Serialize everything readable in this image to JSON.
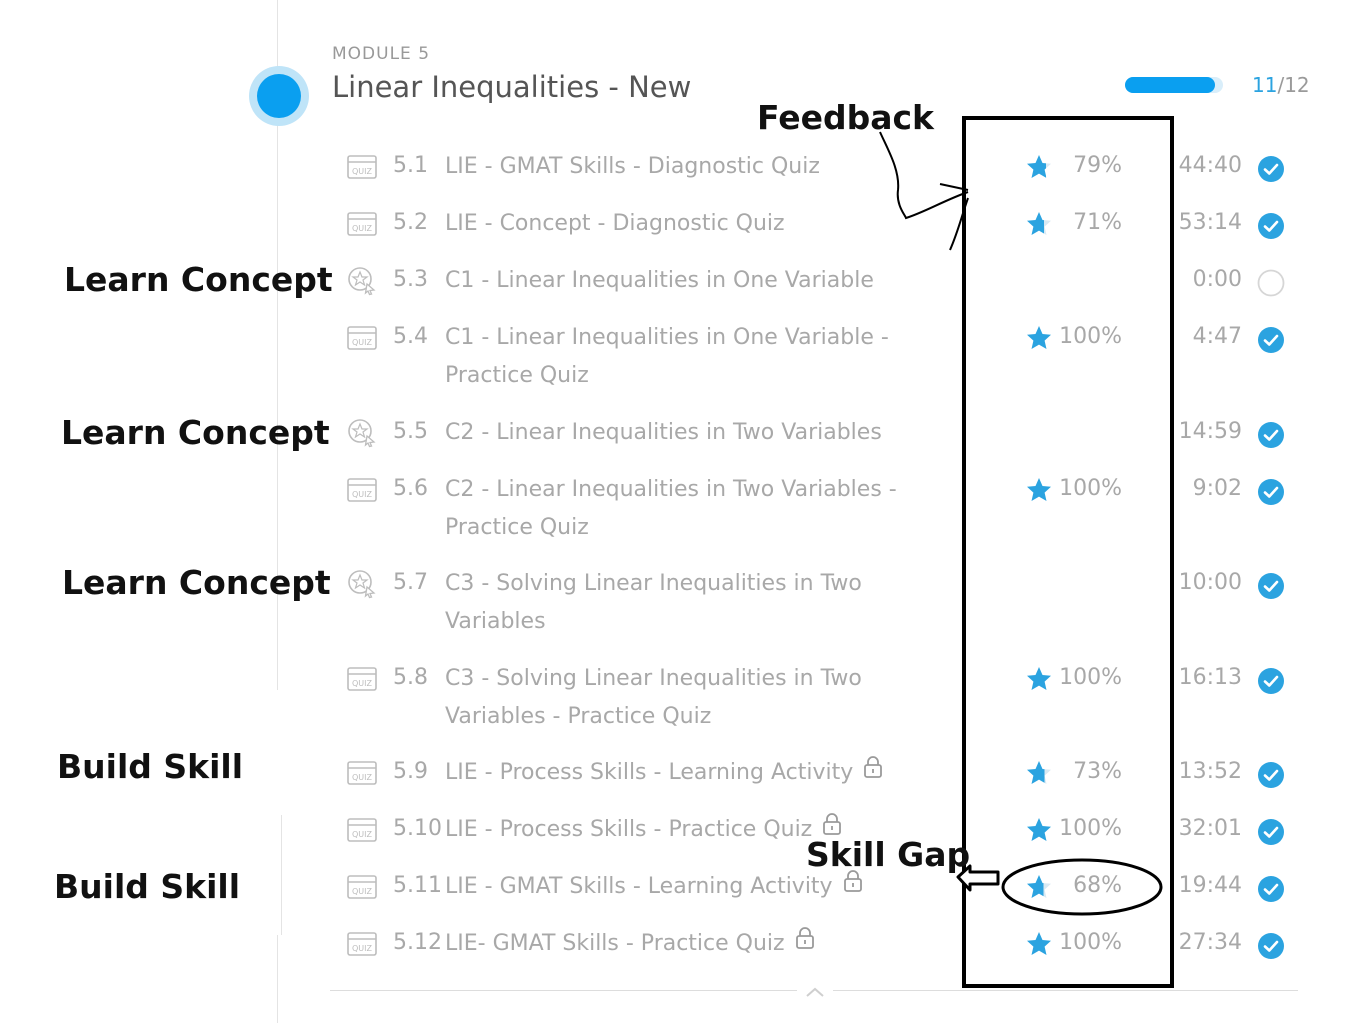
{
  "module": {
    "label": "MODULE 5",
    "title": "Linear Inequalities - New",
    "progress_fraction": 0.917,
    "progress_done": "11",
    "progress_total": "/12"
  },
  "lessons": [
    {
      "num": "5.1",
      "title": "LIE - GMAT Skills - Diagnostic Quiz",
      "icon": "quiz-icon",
      "score": "79%",
      "star_fraction": 0.79,
      "time": "44:40",
      "status": "completed",
      "locked": false
    },
    {
      "num": "5.2",
      "title": "LIE - Concept - Diagnostic Quiz",
      "icon": "quiz-icon",
      "score": "71%",
      "star_fraction": 0.71,
      "time": "53:14",
      "status": "completed",
      "locked": false
    },
    {
      "num": "5.3",
      "title": "C1 - Linear Inequalities in One Variable",
      "icon": "concept-icon",
      "score": "",
      "star_fraction": null,
      "time": "0:00",
      "status": "not-started",
      "locked": false
    },
    {
      "num": "5.4",
      "title": "C1 - Linear Inequalities in One Variable - Practice Quiz",
      "icon": "quiz-icon",
      "score": "100%",
      "star_fraction": 1,
      "time": "4:47",
      "status": "completed",
      "locked": false
    },
    {
      "num": "5.5",
      "title": "C2 - Linear Inequalities in Two Variables",
      "icon": "concept-icon",
      "score": "",
      "star_fraction": null,
      "time": "14:59",
      "status": "completed",
      "locked": false
    },
    {
      "num": "5.6",
      "title": "C2 - Linear Inequalities in Two Variables - Practice Quiz",
      "icon": "quiz-icon",
      "score": "100%",
      "star_fraction": 1,
      "time": "9:02",
      "status": "completed",
      "locked": false
    },
    {
      "num": "5.7",
      "title": "C3 - Solving Linear Inequalities in Two Variables",
      "icon": "concept-icon",
      "score": "",
      "star_fraction": null,
      "time": "10:00",
      "status": "completed",
      "locked": false
    },
    {
      "num": "5.8",
      "title": "C3 - Solving Linear Inequalities in Two Variables - Practice Quiz",
      "icon": "quiz-icon",
      "score": "100%",
      "star_fraction": 1,
      "time": "16:13",
      "status": "completed",
      "locked": false
    },
    {
      "num": "5.9",
      "title": "LIE - Process Skills - Learning Activity",
      "icon": "quiz-icon",
      "score": "73%",
      "star_fraction": 0.73,
      "time": "13:52",
      "status": "completed",
      "locked": true
    },
    {
      "num": "5.10",
      "title": "LIE - Process Skills - Practice Quiz",
      "icon": "quiz-icon",
      "score": "100%",
      "star_fraction": 1,
      "time": "32:01",
      "status": "completed",
      "locked": true
    },
    {
      "num": "5.11",
      "title": "LIE - GMAT Skills - Learning Activity",
      "icon": "quiz-icon",
      "score": "68%",
      "star_fraction": 0.68,
      "time": "19:44",
      "status": "completed",
      "locked": true
    },
    {
      "num": "5.12",
      "title": "LIE- GMAT Skills - Practice Quiz",
      "icon": "quiz-icon",
      "score": "100%",
      "star_fraction": 1,
      "time": "27:34",
      "status": "completed",
      "locked": true
    }
  ],
  "annotations": {
    "feedback": "Feedback",
    "skill_gap": "Skill Gap",
    "learn_concept_1": "Learn Concept",
    "learn_concept_2": "Learn Concept",
    "learn_concept_3": "Learn Concept",
    "build_skill_1": "Build Skill",
    "build_skill_2": "Build Skill"
  },
  "colors": {
    "accent": "#0a9ff0",
    "check": "#2ba3e0",
    "muted_text": "#a8a8a8",
    "annotation": "#111111"
  }
}
